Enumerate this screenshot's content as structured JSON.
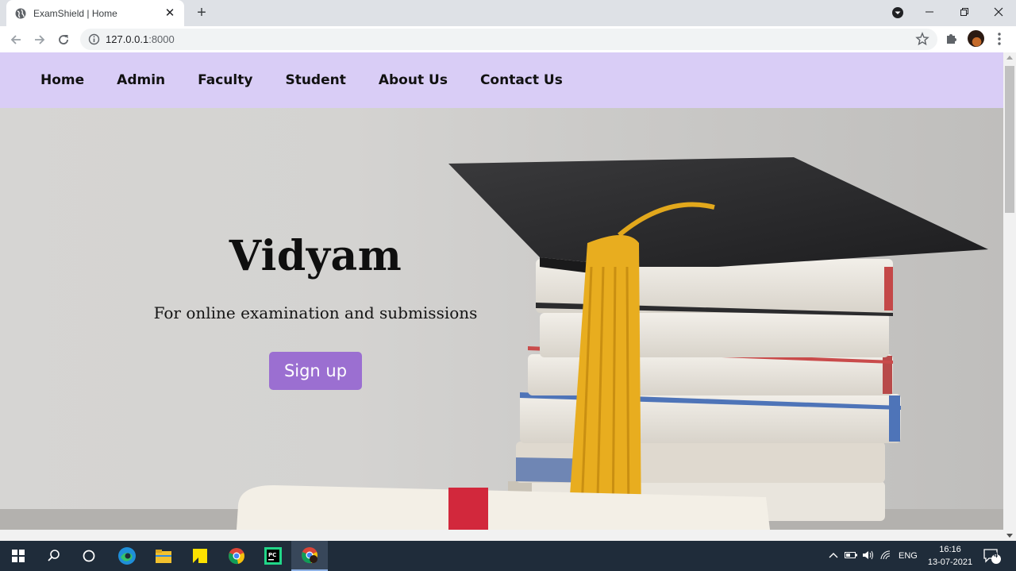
{
  "browser": {
    "tab_title": "ExamShield | Home",
    "new_tab_label": "+",
    "url_host": "127.0.0.1",
    "url_port": ":8000"
  },
  "nav": {
    "items": [
      {
        "label": "Home"
      },
      {
        "label": "Admin"
      },
      {
        "label": "Faculty"
      },
      {
        "label": "Student"
      },
      {
        "label": "About Us"
      },
      {
        "label": "Contact Us"
      }
    ],
    "background": "#d9cdf6"
  },
  "hero": {
    "title": "Vidyam",
    "subtitle": "For online examination and submissions",
    "cta_label": "Sign up",
    "cta_color": "#9b6fd1"
  },
  "taskbar": {
    "apps": [
      "windows-start",
      "search",
      "cortana",
      "edge",
      "file-explorer",
      "sticky-notes",
      "chrome",
      "pycharm",
      "chrome-active"
    ],
    "language": "ENG",
    "time": "16:16",
    "date": "13-07-2021",
    "notification_count": "4"
  }
}
